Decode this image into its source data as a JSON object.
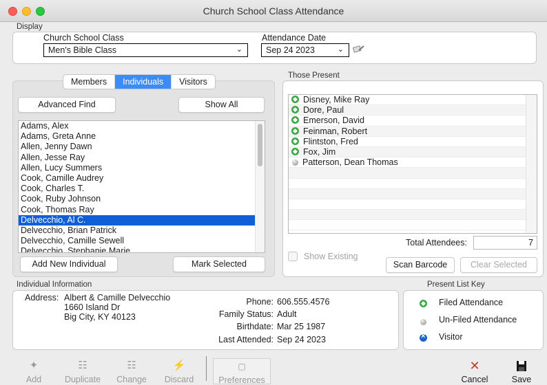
{
  "window": {
    "title": "Church School Class Attendance"
  },
  "display": {
    "group_label": "Display",
    "class_label": "Church School Class",
    "class_value": "Men's Bible Class",
    "date_label": "Attendance Date",
    "date_value": "Sep 24 2023"
  },
  "tabs": [
    {
      "label": "Members",
      "active": false
    },
    {
      "label": "Individuals",
      "active": true
    },
    {
      "label": "Visitors",
      "active": false
    }
  ],
  "buttons": {
    "advanced_find": "Advanced Find",
    "show_all": "Show All",
    "add_new_individual": "Add New Individual",
    "mark_selected": "Mark Selected",
    "scan_barcode": "Scan Barcode",
    "clear_selected": "Clear Selected"
  },
  "individuals": [
    "Adams, Alex",
    "Adams, Greta Anne",
    "Allen, Jenny Dawn",
    "Allen, Jesse Ray",
    "Allen, Lucy Summers",
    "Cook, Camille Audrey",
    "Cook, Charles T.",
    "Cook, Ruby Johnson",
    "Cook, Thomas Ray",
    "Delvecchio, Al C.",
    "Delvecchio, Brian Patrick",
    "Delvecchio, Camille Sewell",
    "Delvecchio, Stephanie Marie"
  ],
  "selected_individual_index": 9,
  "those_present": {
    "label": "Those Present",
    "rows": [
      {
        "name": "Disney, Mike Ray",
        "status": "filed"
      },
      {
        "name": "Dore, Paul",
        "status": "filed"
      },
      {
        "name": "Emerson, David",
        "status": "filed"
      },
      {
        "name": "Feinman, Robert",
        "status": "filed"
      },
      {
        "name": "Flintston, Fred",
        "status": "filed"
      },
      {
        "name": "Fox, Jim",
        "status": "filed"
      },
      {
        "name": "Patterson, Dean Thomas",
        "status": "unfiled"
      }
    ],
    "total_label": "Total Attendees:",
    "total_value": "7",
    "show_existing_label": "Show Existing"
  },
  "individual_info": {
    "group_label": "Individual Information",
    "address_label": "Address:",
    "address_lines": [
      "Albert & Camille Delvecchio",
      "1660 Island Dr",
      "Big City, KY 40123"
    ],
    "phone_label": "Phone:",
    "phone": "606.555.4576",
    "family_status_label": "Family Status:",
    "family_status": "Adult",
    "birthdate_label": "Birthdate:",
    "birthdate": "Mar 25 1987",
    "last_attended_label": "Last Attended:",
    "last_attended": "Sep 24 2023"
  },
  "legend": {
    "group_label": "Present List Key",
    "filed": "Filed Attendance",
    "unfiled": "Un-Filed Attendance",
    "visitor": "Visitor"
  },
  "toolbar": {
    "add": "Add",
    "duplicate": "Duplicate",
    "change": "Change",
    "discard": "Discard",
    "preferences": "Preferences",
    "cancel": "Cancel",
    "save": "Save"
  },
  "colors": {
    "accent": "#3b8cf6",
    "selection": "#0f5fd6",
    "filed": "#3aa845",
    "visitor": "#1f63c8",
    "cancel": "#d0342c"
  }
}
